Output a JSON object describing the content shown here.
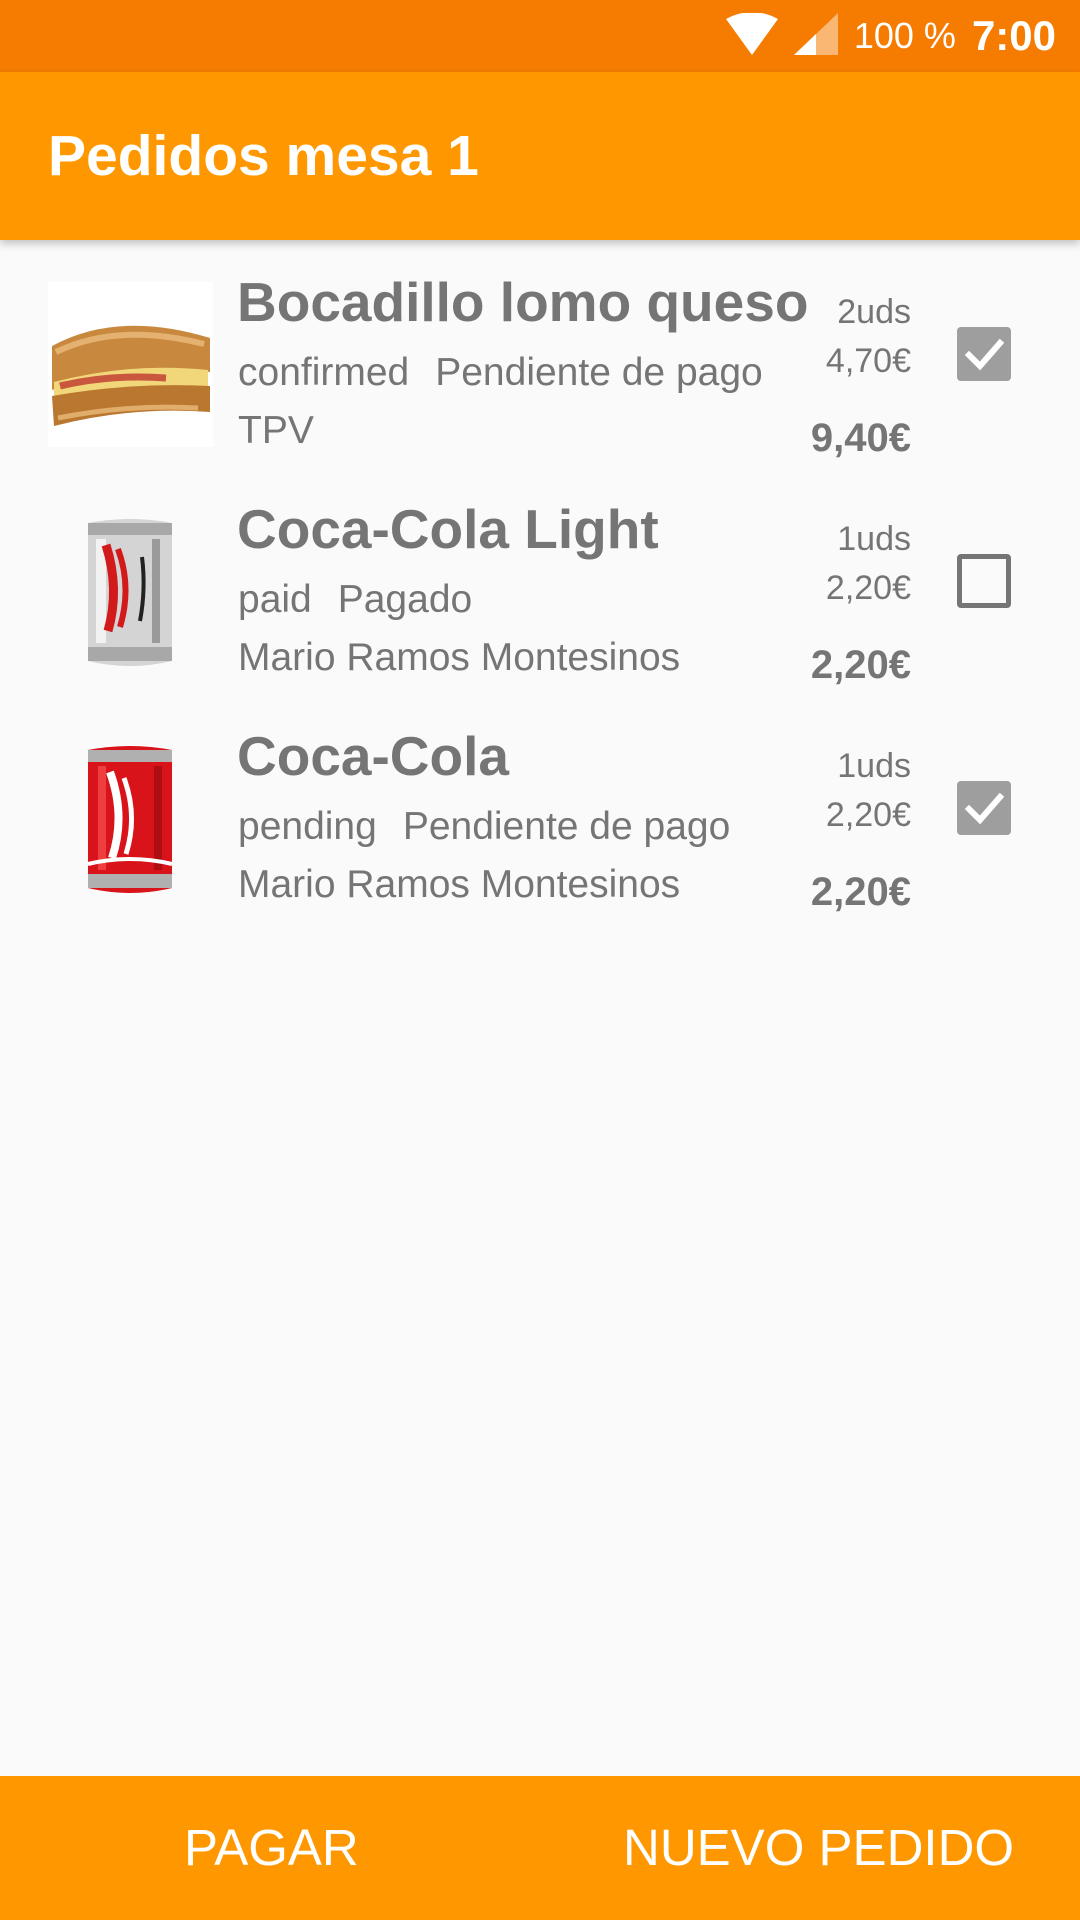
{
  "status_bar": {
    "battery": "100 %",
    "time": "7:00",
    "icons": [
      "wifi-icon",
      "signal-icon"
    ]
  },
  "app_bar": {
    "title": "Pedidos mesa 1"
  },
  "orders": [
    {
      "name": "Bocadillo lomo queso",
      "state": "confirmed",
      "payment": "Pendiente de pago",
      "customer": "TPV",
      "quantity": "2uds",
      "unit_price": "4,70€",
      "total": "9,40€",
      "checked": true,
      "image": "sandwich-image"
    },
    {
      "name": "Coca-Cola Light",
      "state": "paid",
      "payment": "Pagado",
      "customer": "Mario Ramos Montesinos",
      "quantity": "1uds",
      "unit_price": "2,20€",
      "total": "2,20€",
      "checked": false,
      "image": "coca-cola-light-can-image"
    },
    {
      "name": "Coca-Cola",
      "state": "pending",
      "payment": "Pendiente de pago",
      "customer": "Mario Ramos Montesinos",
      "quantity": "1uds",
      "unit_price": "2,20€",
      "total": "2,20€",
      "checked": true,
      "image": "coca-cola-can-image"
    }
  ],
  "bottom_bar": {
    "pay_label": "PAGAR",
    "new_order_label": "NUEVO PEDIDO"
  },
  "colors": {
    "status_bar": "#f57c00",
    "primary": "#ff9800",
    "text_secondary": "#757575",
    "checkbox_checked": "#9e9e9e"
  }
}
